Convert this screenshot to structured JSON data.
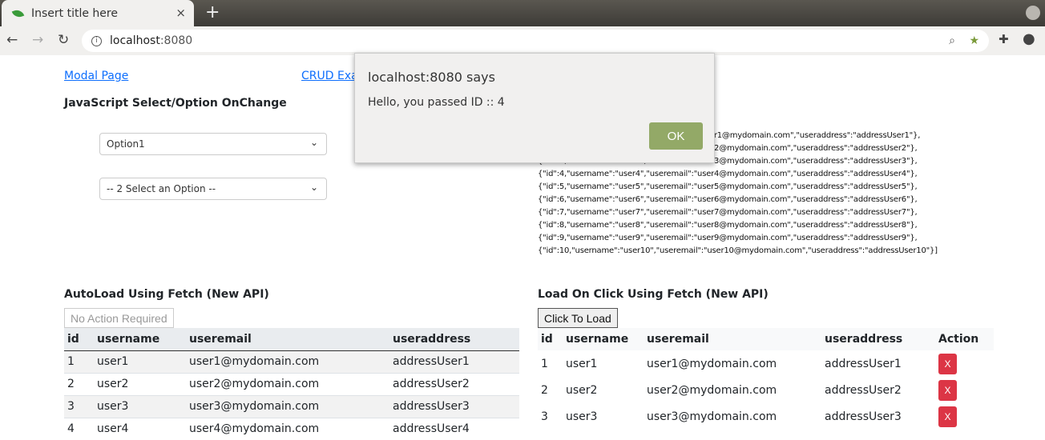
{
  "browser": {
    "tab_title": "Insert title here",
    "new_tab": "+",
    "close": "×",
    "url_host": "localhost",
    "url_port": ":8080"
  },
  "links": {
    "modal": "Modal Page",
    "crud": "CRUD Exa"
  },
  "select_section": {
    "title": "JavaScript Select/Option OnChange",
    "select1": "Option1",
    "select2": "-- 2 Select an Option --"
  },
  "json_lines": [
    "[{\"id\":1,\"username\":\"user1\",\"useremail\":\"user1@mydomain.com\",\"useraddress\":\"addressUser1\"},",
    "{\"id\":2,\"username\":\"user2\",\"useremail\":\"user2@mydomain.com\",\"useraddress\":\"addressUser2\"},",
    "{\"id\":3,\"username\":\"user3\",\"useremail\":\"user3@mydomain.com\",\"useraddress\":\"addressUser3\"},",
    "{\"id\":4,\"username\":\"user4\",\"useremail\":\"user4@mydomain.com\",\"useraddress\":\"addressUser4\"},",
    "{\"id\":5,\"username\":\"user5\",\"useremail\":\"user5@mydomain.com\",\"useraddress\":\"addressUser5\"},",
    "{\"id\":6,\"username\":\"user6\",\"useremail\":\"user6@mydomain.com\",\"useraddress\":\"addressUser6\"},",
    "{\"id\":7,\"username\":\"user7\",\"useremail\":\"user7@mydomain.com\",\"useraddress\":\"addressUser7\"},",
    "{\"id\":8,\"username\":\"user8\",\"useremail\":\"user8@mydomain.com\",\"useraddress\":\"addressUser8\"},",
    "{\"id\":9,\"username\":\"user9\",\"useremail\":\"user9@mydomain.com\",\"useraddress\":\"addressUser9\"},",
    "{\"id\":10,\"username\":\"user10\",\"useremail\":\"user10@mydomain.com\",\"useraddress\":\"addressUser10\"}]"
  ],
  "autoload": {
    "title": "AutoLoad Using Fetch (New API)",
    "button": "No Action Required",
    "headers": [
      "id",
      "username",
      "useremail",
      "useraddress"
    ],
    "rows": [
      [
        "1",
        "user1",
        "user1@mydomain.com",
        "addressUser1"
      ],
      [
        "2",
        "user2",
        "user2@mydomain.com",
        "addressUser2"
      ],
      [
        "3",
        "user3",
        "user3@mydomain.com",
        "addressUser3"
      ],
      [
        "4",
        "user4",
        "user4@mydomain.com",
        "addressUser4"
      ]
    ]
  },
  "onclick": {
    "title": "Load On Click Using Fetch (New API)",
    "button": "Click To Load",
    "headers": [
      "id",
      "username",
      "useremail",
      "useraddress",
      "Action"
    ],
    "delete_label": "X",
    "rows": [
      [
        "1",
        "user1",
        "user1@mydomain.com",
        "addressUser1"
      ],
      [
        "2",
        "user2",
        "user2@mydomain.com",
        "addressUser2"
      ],
      [
        "3",
        "user3",
        "user3@mydomain.com",
        "addressUser3"
      ]
    ]
  },
  "dialog": {
    "title": "localhost:8080 says",
    "message": "Hello, you passed ID :: 4",
    "ok": "OK"
  }
}
